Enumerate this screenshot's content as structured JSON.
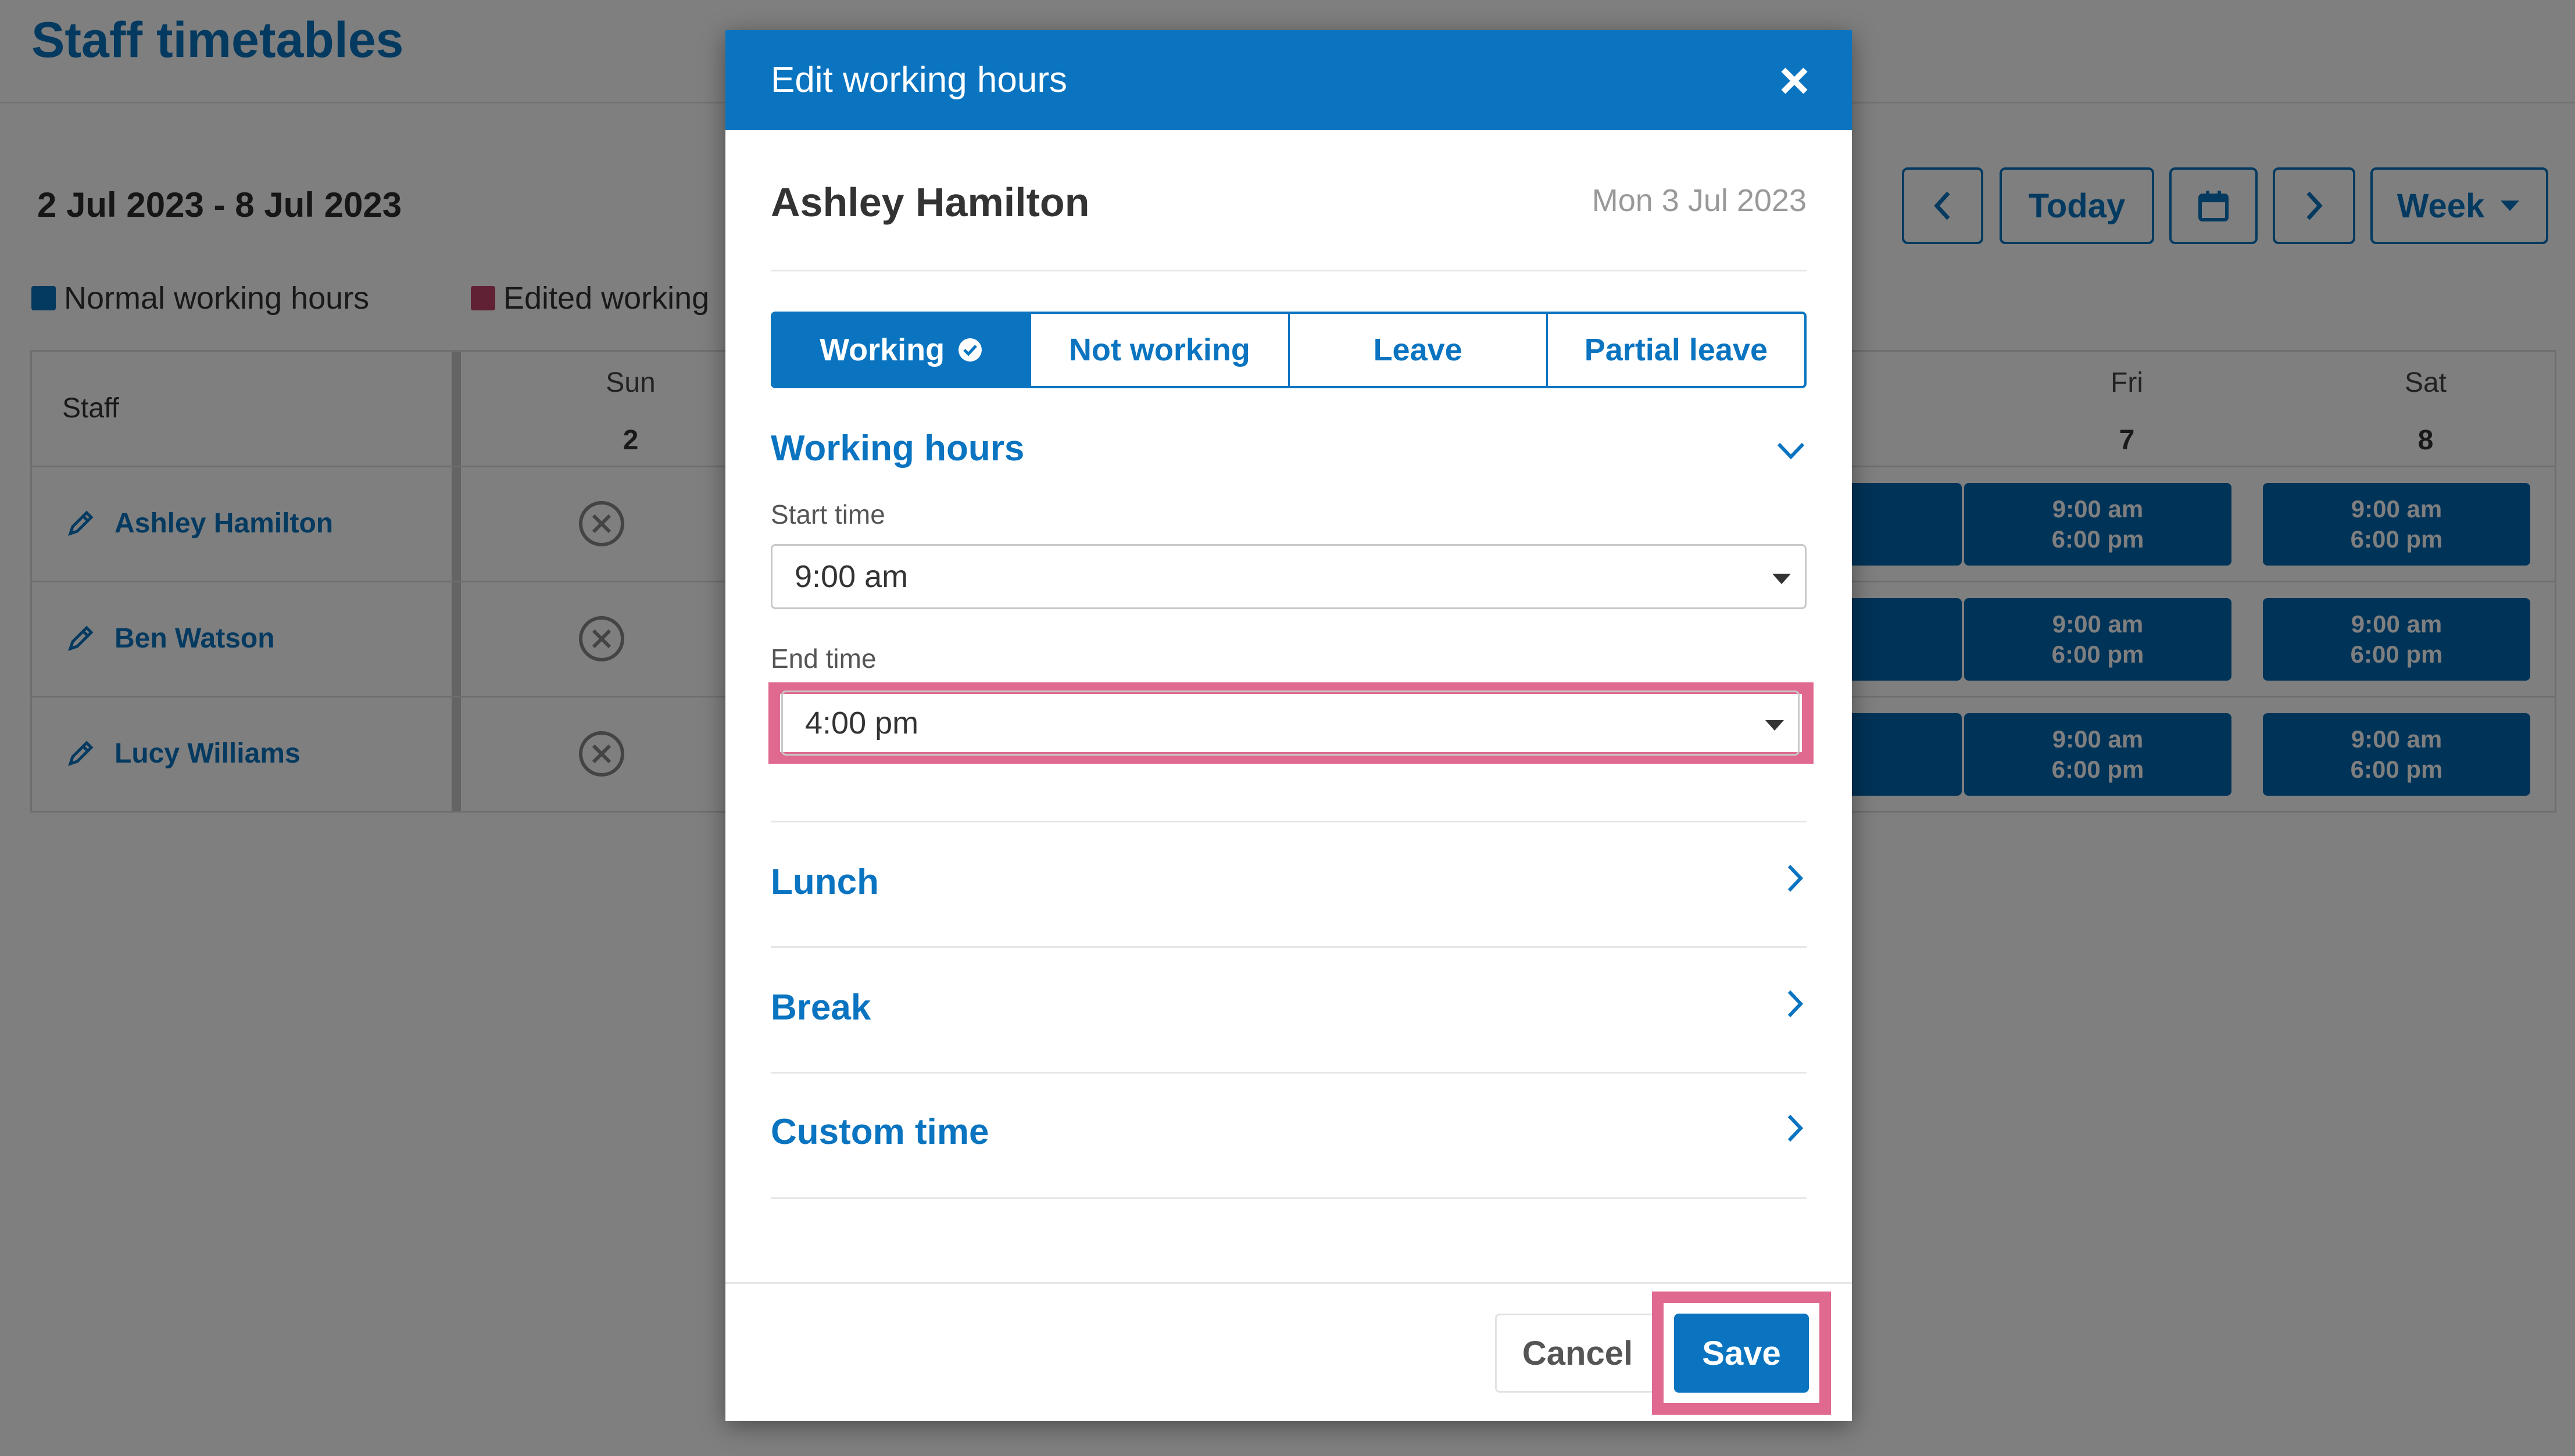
{
  "page": {
    "title": "Staff timetables",
    "date_range": "2 Jul 2023 - 8 Jul 2023",
    "nav": {
      "today": "Today",
      "view": "Week"
    },
    "legend": {
      "normal": "Normal working hours",
      "edited": "Edited working"
    },
    "grid": {
      "staff_header": "Staff",
      "days": [
        {
          "name": "Sun",
          "date": "2"
        },
        {
          "name": "Fri",
          "date": "7"
        },
        {
          "name": "Sat",
          "date": "8"
        }
      ],
      "staff": [
        "Ashley Hamilton",
        "Ben Watson",
        "Lucy Williams"
      ],
      "shift_start": "9:00 am",
      "shift_end": "6:00 pm"
    },
    "colors": {
      "accent": "#0a74c0",
      "shift": "#0067b1",
      "edited": "#c2426a",
      "highlight": "#e0698f"
    }
  },
  "modal": {
    "title": "Edit working hours",
    "person": "Ashley Hamilton",
    "date": "Mon 3 Jul 2023",
    "segments": [
      "Working",
      "Not working",
      "Leave",
      "Partial leave"
    ],
    "working_hours": {
      "heading": "Working hours",
      "start_label": "Start time",
      "start_value": "9:00 am",
      "end_label": "End time",
      "end_value": "4:00 pm"
    },
    "sections": [
      "Lunch",
      "Break",
      "Custom time"
    ],
    "cancel": "Cancel",
    "save": "Save"
  }
}
